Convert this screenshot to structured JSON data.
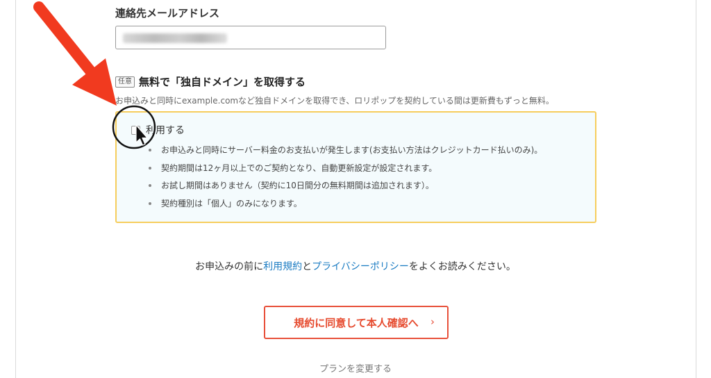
{
  "email": {
    "label": "連絡先メールアドレス",
    "value_redacted": true
  },
  "domain_option": {
    "badge": "任意",
    "title": "無料で「独自ドメイン」を取得する",
    "description": "お申込みと同時にexample.comなど独自ドメインを取得でき、ロリポップを契約している間は更新費もずっと無料。",
    "checkbox_label": "利用する",
    "checked": false,
    "notes": [
      "お申込みと同時にサーバー料金のお支払いが発生します(お支払い方法はクレジットカード払いのみ)。",
      "契約期間は12ヶ月以上でのご契約となり、自動更新設定が設定されます。",
      "お試し期間はありません（契約に10日間分の無料期間は追加されます）。",
      "契約種別は「個人」のみになります。"
    ]
  },
  "terms": {
    "prefix": "お申込みの前に",
    "terms_link": "利用規約",
    "conjunction": "と",
    "privacy_link": "プライバシーポリシー",
    "suffix": "をよくお読みください。"
  },
  "actions": {
    "agree_label": "規約に同意して本人確認へ",
    "chevron": "›",
    "change_plan_label": "プランを変更する"
  },
  "colors": {
    "accent": "#e8503a",
    "link": "#1a7bc2",
    "option_border": "#f6cd5c",
    "option_bg": "#f4fbfd",
    "annotation_arrow": "#f13a1f"
  },
  "icons": {
    "arrow": "annotation-arrow-icon",
    "highlight": "highlight-circle-icon",
    "cursor": "mouse-pointer-icon"
  }
}
